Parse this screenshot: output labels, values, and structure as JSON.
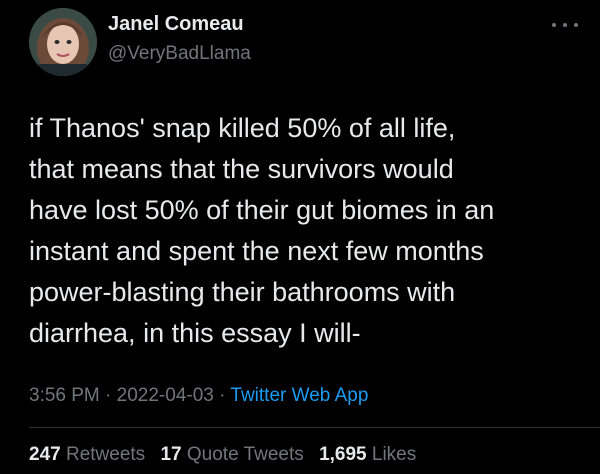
{
  "author": {
    "name": "Janel Comeau",
    "handle": "@VeryBadLlama",
    "avatar_icon": "profile-photo"
  },
  "more_icon": "ellipsis-icon",
  "tweet": {
    "lines": [
      "if Thanos' snap killed 50% of all life,",
      "that means that the survivors would",
      "have lost 50% of their gut biomes in an",
      "instant and spent the next few months",
      "power-blasting their bathrooms with",
      "diarrhea, in this essay I will-"
    ]
  },
  "meta": {
    "time": "3:56 PM",
    "separator": "·",
    "date": "2022-04-03",
    "source": "Twitter Web App"
  },
  "stats": {
    "retweets_count": "247",
    "retweets_label": "Retweets",
    "quotes_count": "17",
    "quotes_label": "Quote Tweets",
    "likes_count": "1,695",
    "likes_label": "Likes"
  },
  "colors": {
    "background": "#000000",
    "primary_text": "#e7e9ea",
    "secondary_text": "#71767b",
    "link": "#1d9bf0"
  }
}
